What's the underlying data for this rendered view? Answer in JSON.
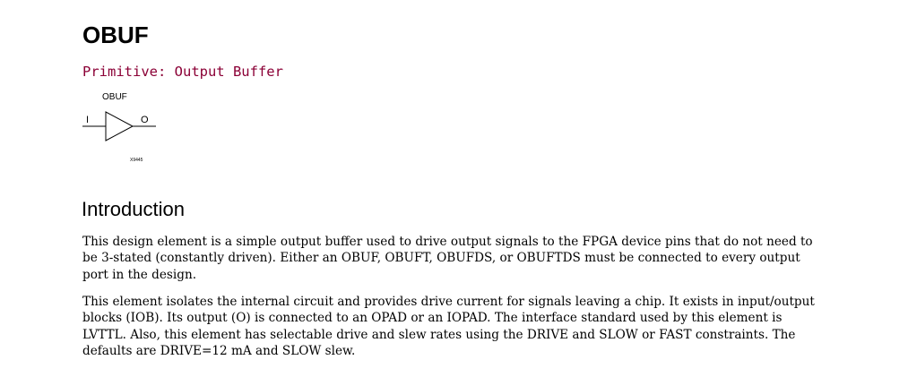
{
  "title": "OBUF",
  "subtitle": "Primitive: Output Buffer",
  "colors": {
    "subtitle": "#8b0036",
    "text": "#000000"
  },
  "symbol": {
    "label": "OBUF",
    "input_pin": "I",
    "output_pin": "O",
    "figure_id": "X9445"
  },
  "introduction": {
    "heading": "Introduction",
    "paragraphs": [
      "This design element is a simple output buffer used to drive output signals to the FPGA device pins that do not need to be 3-stated (constantly driven). Either an OBUF, OBUFT, OBUFDS, or OBUFTDS must be connected to every output port in the design.",
      "This element isolates the internal circuit and provides drive current for signals leaving a chip. It exists in input/output blocks (IOB). Its output (O) is connected to an OPAD or an IOPAD. The interface standard used by this element is LVTTL. Also, this element has selectable drive and slew rates using the DRIVE and SLOW or FAST constraints. The defaults are DRIVE=12 mA and SLOW slew."
    ]
  }
}
